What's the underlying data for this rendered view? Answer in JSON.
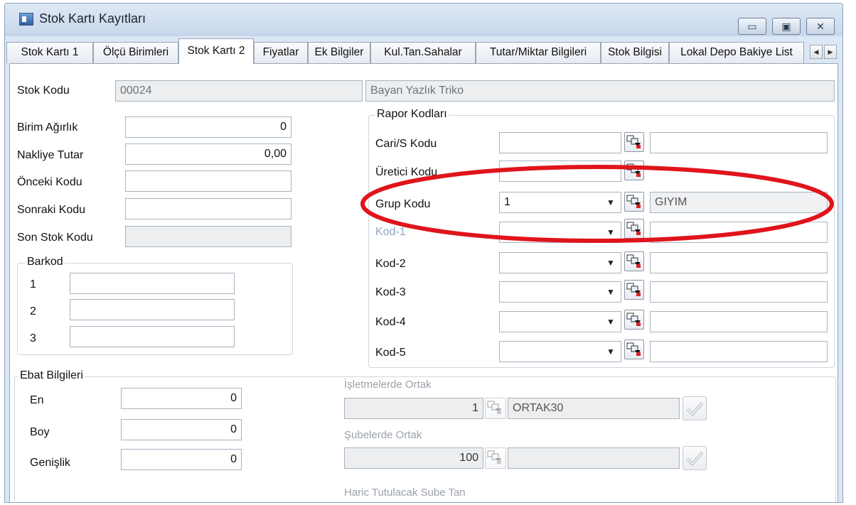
{
  "window": {
    "title": "Stok Kartı Kayıtları",
    "controls": {
      "minimize": "▭",
      "maximize": "▣",
      "close": "✕"
    }
  },
  "tabs": [
    {
      "label": "Stok Kartı 1"
    },
    {
      "label": "Ölçü Birimleri"
    },
    {
      "label": "Stok Kartı 2"
    },
    {
      "label": "Fiyatlar"
    },
    {
      "label": "Ek Bilgiler"
    },
    {
      "label": "Kul.Tan.Sahalar"
    },
    {
      "label": "Tutar/Miktar Bilgileri"
    },
    {
      "label": "Stok Bilgisi"
    },
    {
      "label": "Lokal Depo Bakiye List"
    }
  ],
  "tab_scroll": {
    "left": "◀",
    "right": "▶"
  },
  "stock": {
    "code_label": "Stok Kodu",
    "code_value": "00024",
    "name_value": "Bayan Yazlık Triko"
  },
  "left_fields": {
    "birim_agirlik": {
      "label": "Birim Ağırlık",
      "value": "0"
    },
    "nakliye_tutar": {
      "label": "Nakliye Tutar",
      "value": "0,00"
    },
    "onceki_kodu": {
      "label": "Önceki Kodu",
      "value": ""
    },
    "sonraki_kodu": {
      "label": "Sonraki Kodu",
      "value": ""
    },
    "son_stok_kodu": {
      "label": "Son Stok Kodu",
      "value": ""
    }
  },
  "barkod": {
    "title": "Barkod",
    "rows": [
      {
        "num": "1",
        "value": ""
      },
      {
        "num": "2",
        "value": ""
      },
      {
        "num": "3",
        "value": ""
      }
    ]
  },
  "rapor": {
    "title": "Rapor Kodları",
    "rows": [
      {
        "label": "Cari/S Kodu",
        "value": "",
        "desc": ""
      },
      {
        "label": "Üretici Kodu",
        "value": "",
        "desc": ""
      },
      {
        "label": "Grup Kodu",
        "value": "1",
        "desc": "GIYIM"
      },
      {
        "label": "Kod-1",
        "value": "",
        "desc": ""
      },
      {
        "label": "Kod-2",
        "value": "",
        "desc": ""
      },
      {
        "label": "Kod-3",
        "value": "",
        "desc": ""
      },
      {
        "label": "Kod-4",
        "value": "",
        "desc": ""
      },
      {
        "label": "Kod-5",
        "value": "",
        "desc": ""
      }
    ],
    "combo_arrow": "▼"
  },
  "ebat": {
    "title": "Ebat Bilgileri",
    "rows": [
      {
        "label": "En",
        "value": "0"
      },
      {
        "label": "Boy",
        "value": "0"
      },
      {
        "label": "Genişlik",
        "value": "0"
      }
    ]
  },
  "ortak": {
    "isletmelerde_label": "İşletmelerde Ortak",
    "isletmelerde_value": "1",
    "isletmelerde_desc": "ORTAK30",
    "subelerde_label": "Şubelerde Ortak",
    "subelerde_value": "100",
    "subelerde_desc": "",
    "haric_label": "Haric Tutulacak Sube Tan"
  },
  "colors": {
    "highlight": "#e0141b",
    "window_border": "#8ea3bf"
  }
}
